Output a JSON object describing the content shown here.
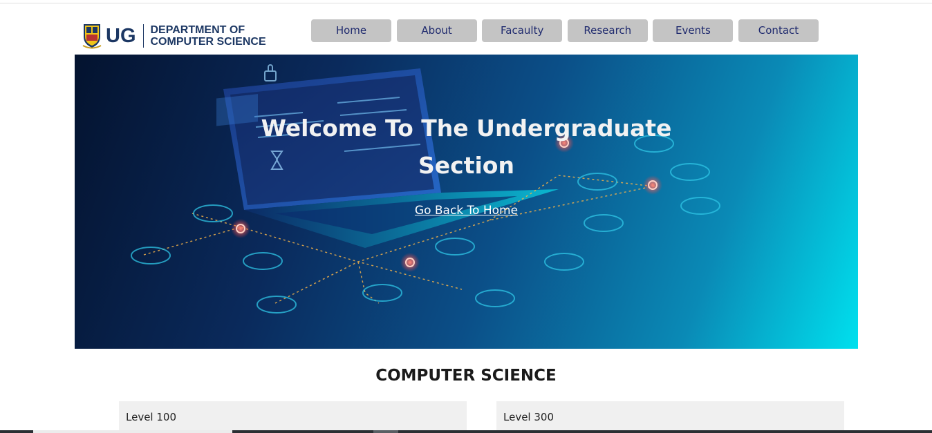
{
  "logo": {
    "short": "UG",
    "line1": "DEPARTMENT OF",
    "line2": "COMPUTER SCIENCE"
  },
  "nav": {
    "items": [
      {
        "label": "Home"
      },
      {
        "label": "About"
      },
      {
        "label": "Facaulty"
      },
      {
        "label": "Research"
      },
      {
        "label": "Events"
      },
      {
        "label": "Contact"
      }
    ]
  },
  "hero": {
    "title_line1": "Welcome To The Undergraduate",
    "title_line2": "Section",
    "link_label": "Go Back To Home"
  },
  "section": {
    "title": "COMPUTER SCIENCE",
    "levels": [
      {
        "label": "Level 100"
      },
      {
        "label": "Level 300"
      }
    ]
  },
  "colors": {
    "brand": "#1c3763",
    "nav_bg": "#c4c4c4",
    "nav_text": "#1f2a6e",
    "hero_dark": "#04132f",
    "hero_light": "#00e0ee"
  },
  "icons": [
    "university-crest-icon",
    "laptop-illustration",
    "network-node-icon"
  ]
}
